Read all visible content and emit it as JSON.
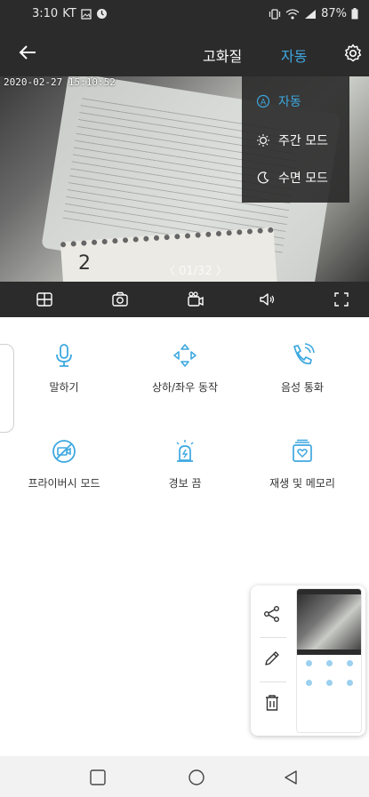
{
  "status_bar": {
    "time": "3:10",
    "carrier": "KT",
    "battery": "87%",
    "icons": [
      "gallery-icon",
      "alarm-icon",
      "vibrate-icon",
      "wifi-icon",
      "signal-icon",
      "battery-icon"
    ]
  },
  "app_bar": {
    "quality_label": "고화질",
    "mode_label": "자동",
    "back_icon": "arrow-left-icon",
    "settings_icon": "gear-icon"
  },
  "video": {
    "timestamp": "2020-02-27 15:10:52",
    "pager": "〈 01/32 〉",
    "calendar_number": "2"
  },
  "mode_menu": {
    "items": [
      {
        "label": "자동",
        "icon": "auto-a-icon",
        "selected": true
      },
      {
        "label": "주간 모드",
        "icon": "sun-icon",
        "selected": false
      },
      {
        "label": "수면 모드",
        "icon": "moon-icon",
        "selected": false
      }
    ]
  },
  "control_bar": {
    "icons": [
      "grid-layout-icon",
      "camera-snapshot-icon",
      "video-record-icon",
      "speaker-icon",
      "fullscreen-icon"
    ]
  },
  "features": [
    {
      "label": "말하기",
      "icon": "microphone-icon"
    },
    {
      "label": "상하/좌우 동작",
      "icon": "pan-tilt-arrows-icon"
    },
    {
      "label": "음성 통화",
      "icon": "phone-call-icon"
    },
    {
      "label": "프라이버시 모드",
      "icon": "privacy-camera-off-icon"
    },
    {
      "label": "경보 끔",
      "icon": "siren-icon"
    },
    {
      "label": "재생 및 메모리",
      "icon": "playback-memory-icon"
    }
  ],
  "screenshot_popup": {
    "actions": [
      "share-icon",
      "edit-pencil-icon",
      "delete-trash-icon"
    ]
  },
  "nav_bar": {
    "icons": [
      "recent-apps-icon",
      "home-icon",
      "back-triangle-icon"
    ]
  },
  "colors": {
    "accent": "#3ea8e0",
    "dark_bar": "#2b2b2b",
    "nav_bg": "#f2f2f2"
  }
}
